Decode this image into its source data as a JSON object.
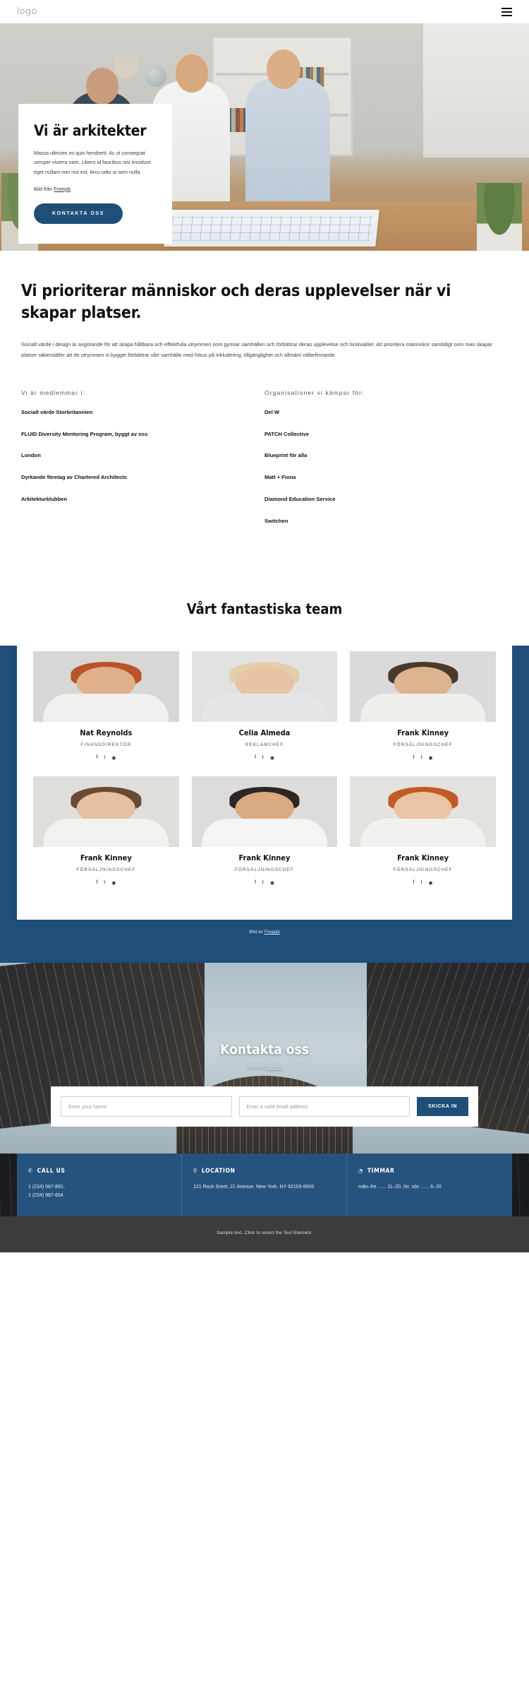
{
  "header": {
    "logo": "logo",
    "menu_icon": "hamburger-menu-icon"
  },
  "hero": {
    "title": "Vi är arkitekter",
    "paragraph": "Massa ultricies mi quis hendrerit. Ac ut consequat semper viverra nam. Libero id faucibus nisl tincidunt eget nullam non nisi est. Arcu odio ut sem nulla.",
    "credit_prefix": "Bild från ",
    "credit_link": "Freepik",
    "cta": "KONTAKTA OSS"
  },
  "priority": {
    "heading": "Vi prioriterar människor och deras upplevelser när vi skapar platser.",
    "paragraph": "Socialt värde i design är avgörande för att skapa hållbara och effektfulla utrymmen som gynnar samhällen och förbättrar deras upplevelse och livskvalitet. Att prioritera människor samtidigt som man skapar platser säkerställer att de utrymmen vi bygger förbättrar vårt samhälle med fokus på inkludering, tillgänglighet och allmänt välbefinnande.",
    "left_column": {
      "heading": "Vi är medlemmar i:",
      "items": [
        "Socialt värde Storbritannien",
        "FLUID Diversity Mentoring Program, byggt av oss",
        "London",
        "Dyrkande företag av Chartered Architects",
        "Arkitekturklubben"
      ]
    },
    "right_column": {
      "heading": "Organisationer vi kämpar för:",
      "items": [
        "Del W",
        "PATCH Collective",
        "Blueprint för alla",
        "Matt + Fiona",
        "Diamond Education Service",
        "Switchen"
      ]
    }
  },
  "team": {
    "title": "Vårt fantastiska team",
    "credit_prefix": "Bild av ",
    "credit_link": "Freepik",
    "social_icons": [
      "facebook-icon",
      "twitter-icon",
      "instagram-icon"
    ],
    "social_glyphs": [
      "f",
      "t",
      "◉"
    ],
    "members": [
      {
        "name": "Nat Reynolds",
        "role": "FINANSDIREKTÖR",
        "hair": "#b8542a",
        "skin": "#e0b08a",
        "shirt": "#f0f0ee",
        "bg": "#d7d7d5"
      },
      {
        "name": "Celia Almeda",
        "role": "REKLAMCHEF",
        "hair": "#e2cfa8",
        "skin": "#e8c3a4",
        "shirt": "#e6e6e8",
        "bg": "#e2e2e2"
      },
      {
        "name": "Frank Kinney",
        "role": "FÖRSÄLJNINGSCHEF",
        "hair": "#4a3a2c",
        "skin": "#ddb390",
        "shirt": "#efefec",
        "bg": "#dadada"
      },
      {
        "name": "Frank Kinney",
        "role": "FÖRSÄLJNINGSCHEF",
        "hair": "#6b4a33",
        "skin": "#e6c0a2",
        "shirt": "#f2f2f0",
        "bg": "#e0dedb"
      },
      {
        "name": "Frank Kinney",
        "role": "FÖRSÄLJNINGSCHEF",
        "hair": "#2e2620",
        "skin": "#d9a97f",
        "shirt": "#f4f4f2",
        "bg": "#dcdcdc"
      },
      {
        "name": "Frank Kinney",
        "role": "FÖRSÄLJNINGSCHEF",
        "hair": "#c05a26",
        "skin": "#eac4a4",
        "shirt": "#f1f1ef",
        "bg": "#e4e2df"
      }
    ]
  },
  "contact": {
    "title": "Kontakta oss",
    "credit_prefix": "Bild från ",
    "credit_link": "Freepik",
    "name_placeholder": "Enter your Name",
    "email_placeholder": "Enter a valid email address",
    "submit": "SKICKA IN"
  },
  "info_bar": [
    {
      "icon": "phone-icon",
      "glyph": "✆",
      "title": "CALL US",
      "body": "1 (234) 567-891,\n1 (234) 987-654"
    },
    {
      "icon": "location-pin-icon",
      "glyph": "⚲",
      "title": "LOCATION",
      "body": "121 Rock Sreet, 21 Avenue, New York, NY 92103-9000"
    },
    {
      "icon": "clock-icon",
      "glyph": "◔",
      "title": "TIMMAR",
      "body": "mån–fre ...... 11–20, lör, sön  ...... 6–20"
    }
  ],
  "footer": {
    "text": "Sample text. Click to select the Text Element."
  },
  "colors": {
    "brand_blue": "#1f4e79",
    "info_blue": "#26527e",
    "footer_gray": "#3c3c3c"
  }
}
